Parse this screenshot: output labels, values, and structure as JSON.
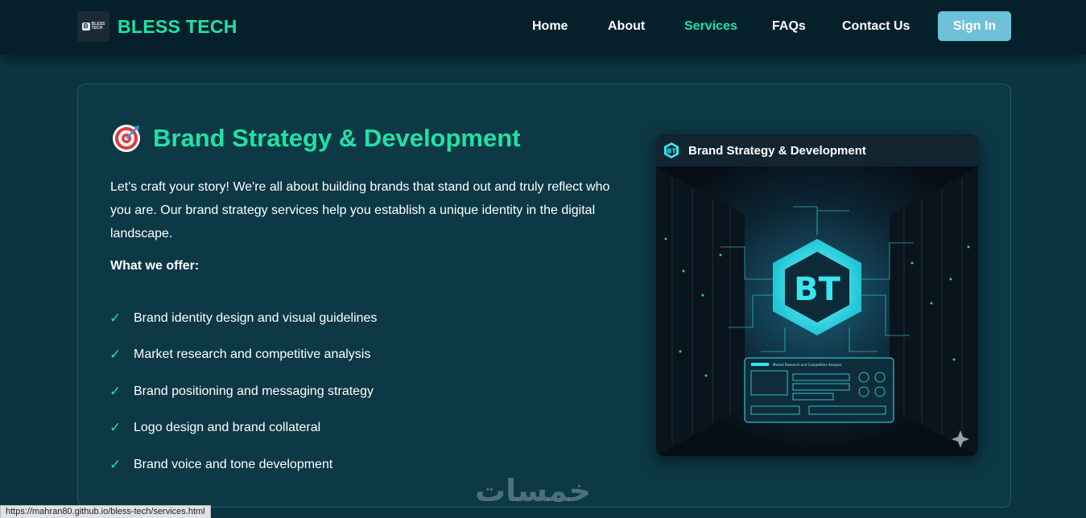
{
  "brand": {
    "logo_text_top": "BLESS",
    "logo_text_bottom": "TECH",
    "name": "BLESS TECH"
  },
  "nav": {
    "items": [
      {
        "label": "Home"
      },
      {
        "label": "About"
      },
      {
        "label": "Services",
        "active": true
      },
      {
        "label": "FAQs"
      },
      {
        "label": "Contact Us"
      }
    ],
    "signin_label": "Sign In"
  },
  "service": {
    "icon": "target-icon",
    "title": "Brand Strategy & Development",
    "description": "Let's craft your story! We're all about building brands that stand out and truly reflect who you are. Our brand strategy services help you establish a unique identity in the digital landscape.",
    "offer_heading": "What we offer:",
    "offers": [
      "Brand identity design and visual guidelines",
      "Market research and competitive analysis",
      "Brand positioning and messaging strategy",
      "Logo design and brand collateral",
      "Brand voice and tone development"
    ],
    "check_glyph": "✓",
    "image_card": {
      "title": "Brand Strategy & Development",
      "logo_text": "BT",
      "dashboard_title": "Market Research and Competitive Analysis"
    }
  },
  "watermark": "خمسات",
  "status_url": "https://mahran80.github.io/bless-tech/services.html",
  "colors": {
    "accent": "#1ee3a4",
    "background": "#0a3440",
    "navbar": "#06202b",
    "signin": "#6fc1da",
    "cyan_glow": "#37e6f0"
  }
}
